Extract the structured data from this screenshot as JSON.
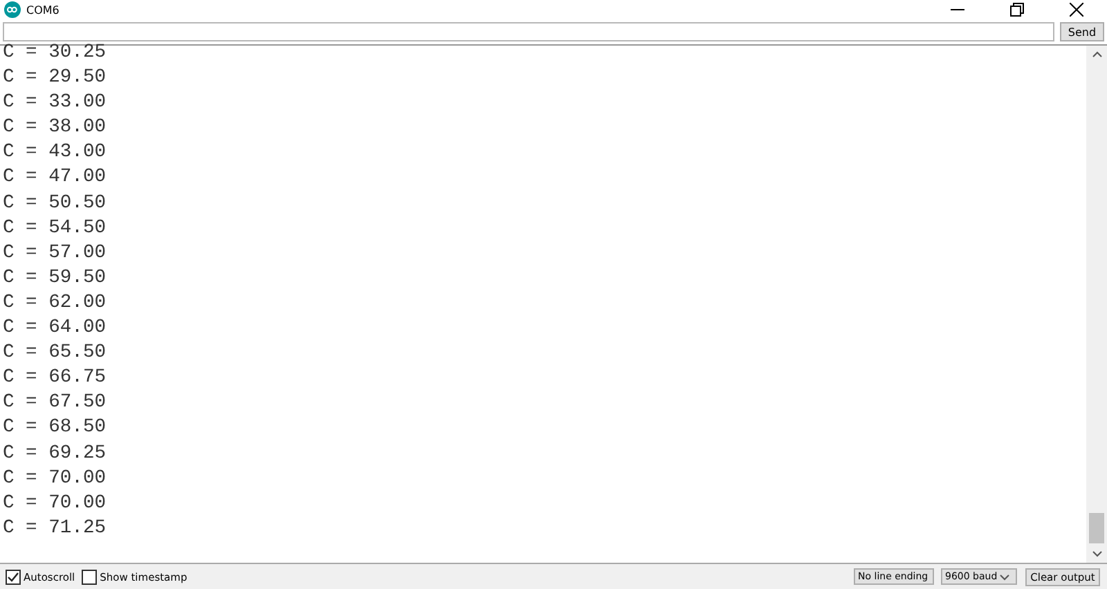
{
  "window": {
    "title": "COM6"
  },
  "send_button": "Send",
  "output_lines": [
    "C = 30.25",
    "C = 29.50",
    "C = 33.00",
    "C = 38.00",
    "C = 43.00",
    "C = 47.00",
    "C = 50.50",
    "C = 54.50",
    "C = 57.00",
    "C = 59.50",
    "C = 62.00",
    "C = 64.00",
    "C = 65.50",
    "C = 66.75",
    "C = 67.50",
    "C = 68.50",
    "C = 69.25",
    "C = 70.00",
    "C = 70.00",
    "C = 71.25"
  ],
  "options": [
    {
      "label": "Autoscroll",
      "checked": true
    },
    {
      "label": "Show timestamp",
      "checked": false
    }
  ],
  "dropdowns": [
    "No line ending",
    "9600 baud"
  ],
  "clear_button": "Clear output"
}
